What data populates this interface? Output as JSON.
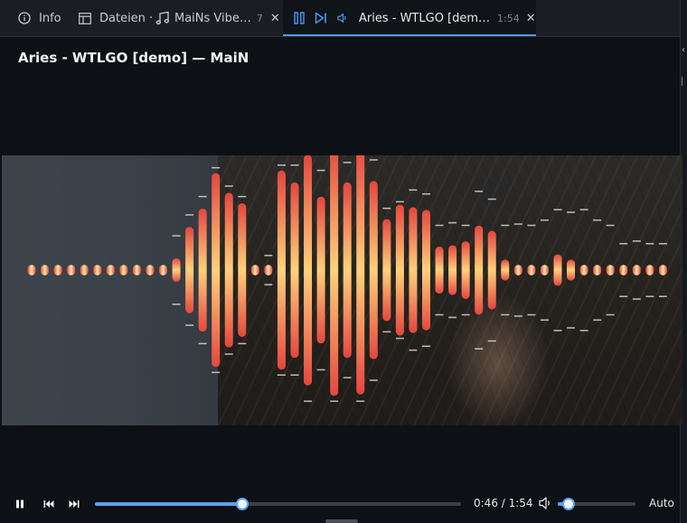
{
  "tabs": {
    "info": {
      "label": "Info"
    },
    "files": {
      "label": "Dateien ·"
    },
    "vibes": {
      "label": "MaiNs Vibe…",
      "count": "7"
    },
    "player": {
      "label": "Aries - WTLGO [dem…",
      "duration": "1:54"
    }
  },
  "player": {
    "title": "Aries - WTLGO [demo] — MaiN",
    "current_time": "0:46",
    "total_time": "1:54",
    "time_display": "0:46 / 1:54",
    "progress_fraction": 0.4035,
    "volume_fraction": 0.14,
    "quality": "Auto"
  },
  "colors": {
    "accent": "#5aa4f0",
    "tab_active_indicator": "#4a9bf2",
    "bar_outer": "#e4463f",
    "bar_inner": "#ffe9a8",
    "peak_marker": "#d8d8d8"
  },
  "visualizer": {
    "peak_magnitudes": [
      0.04,
      0.04,
      0.04,
      0.04,
      0.04,
      0.04,
      0.04,
      0.04,
      0.04,
      0.04,
      0.04,
      0.09,
      0.33,
      0.47,
      0.74,
      0.59,
      0.51,
      0.04,
      0.04,
      0.76,
      0.67,
      0.88,
      0.56,
      0.96,
      0.67,
      0.95,
      0.68,
      0.39,
      0.5,
      0.48,
      0.46,
      0.18,
      0.19,
      0.22,
      0.34,
      0.3,
      0.08,
      0.04,
      0.04,
      0.04,
      0.12,
      0.08,
      0.04,
      0.04,
      0.04,
      0.04,
      0.04,
      0.04,
      0.04
    ],
    "bar_magnitudes": [
      0.04,
      0.04,
      0.04,
      0.04,
      0.04,
      0.04,
      0.04,
      0.04,
      0.04,
      0.04,
      0.04,
      0.09,
      0.33,
      0.47,
      0.74,
      0.59,
      0.51,
      0.04,
      0.04,
      0.76,
      0.67,
      0.88,
      0.56,
      0.96,
      0.67,
      0.95,
      0.68,
      0.39,
      0.5,
      0.48,
      0.46,
      0.18,
      0.19,
      0.22,
      0.34,
      0.3,
      0.08,
      0.04,
      0.04,
      0.04,
      0.12,
      0.08,
      0.04,
      0.04,
      0.04,
      0.04,
      0.04,
      0.04,
      0.04
    ],
    "peak_levels": [
      0,
      0,
      0,
      0,
      0,
      0,
      0,
      0,
      0,
      0,
      0,
      0.22,
      0.38,
      0.52,
      0.74,
      0.6,
      0.52,
      0,
      0.07,
      0.76,
      0.76,
      0.96,
      0.72,
      0.96,
      0.78,
      0.96,
      0.8,
      0.43,
      0.48,
      0.57,
      0.54,
      0.3,
      0.32,
      0.3,
      0.56,
      0.5,
      0.3,
      0.31,
      0.3,
      0.34,
      0.42,
      0.4,
      0.42,
      0.34,
      0.3,
      0.16,
      0.18,
      0.16,
      0.16
    ]
  }
}
